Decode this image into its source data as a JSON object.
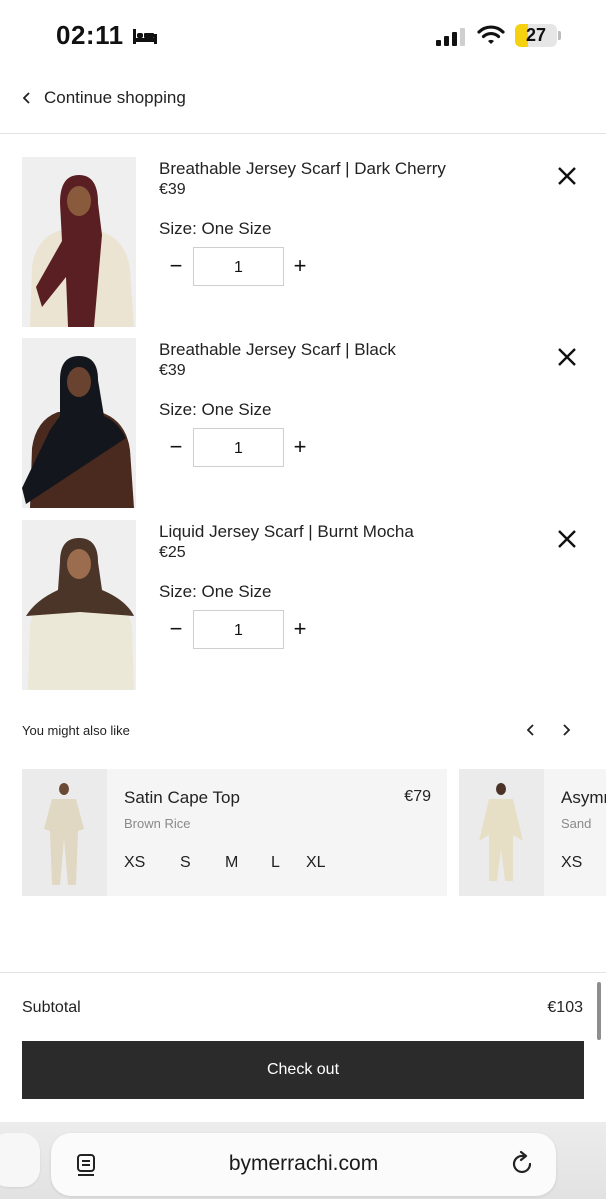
{
  "status_bar": {
    "time": "02:11",
    "battery": "27"
  },
  "header": {
    "continue_label": "Continue shopping"
  },
  "cart": {
    "items": [
      {
        "title": "Breathable Jersey Scarf | Dark Cherry",
        "price": "€39",
        "size": "Size: One Size",
        "qty": "1",
        "scarf_color": "#5a1f22",
        "top_color": "#ece4d2"
      },
      {
        "title": "Breathable Jersey Scarf | Black",
        "price": "€39",
        "size": "Size: One Size",
        "qty": "1",
        "scarf_color": "#14161d",
        "top_color": "#4a2a1f"
      },
      {
        "title": "Liquid Jersey Scarf | Burnt Mocha",
        "price": "€25",
        "size": "Size: One Size",
        "qty": "1",
        "scarf_color": "#4b3428",
        "top_color": "#ece8d7"
      }
    ],
    "minus_symbol": "−",
    "plus_symbol": "+"
  },
  "recommendations": {
    "heading": "You might also like",
    "products": [
      {
        "name": "Satin Cape Top",
        "price": "€79",
        "color": "Brown Rice",
        "sizes": [
          "XS",
          "S",
          "M",
          "L",
          "XL"
        ]
      },
      {
        "name": "Asymm",
        "price": "",
        "color": "Sand",
        "sizes": [
          "XS"
        ]
      }
    ]
  },
  "summary": {
    "subtotal_label": "Subtotal",
    "subtotal_value": "€103",
    "checkout_label": "Check out"
  },
  "browser": {
    "url": "bymerrachi.com"
  }
}
